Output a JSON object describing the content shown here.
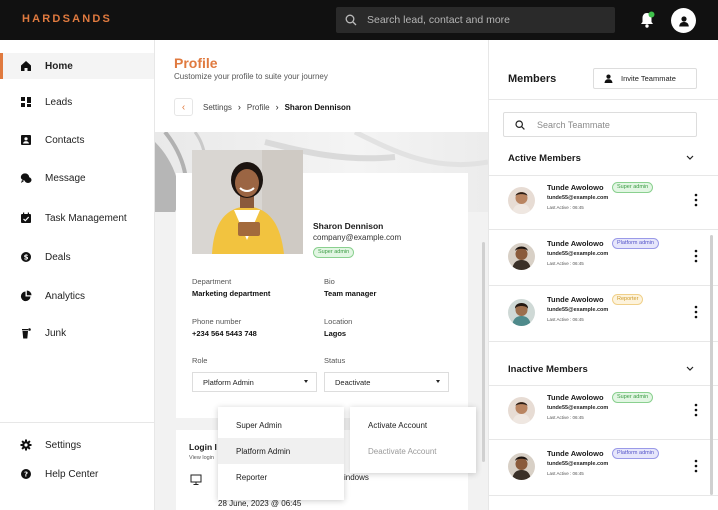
{
  "app": {
    "logo": "HARDSANDS"
  },
  "topbar": {
    "search_placeholder": "Search lead, contact and more"
  },
  "sidebar": {
    "items": [
      {
        "label": "Home",
        "icon": "home-icon",
        "active": true
      },
      {
        "label": "Leads",
        "icon": "leads-icon"
      },
      {
        "label": "Contacts",
        "icon": "contacts-icon"
      },
      {
        "label": "Message",
        "icon": "message-icon"
      },
      {
        "label": "Task Management",
        "icon": "task-icon"
      },
      {
        "label": "Deals",
        "icon": "deals-icon"
      },
      {
        "label": "Analytics",
        "icon": "analytics-icon"
      },
      {
        "label": "Junk",
        "icon": "junk-icon"
      }
    ],
    "bottom": [
      {
        "label": "Settings",
        "icon": "gear-icon"
      },
      {
        "label": "Help Center",
        "icon": "help-icon"
      }
    ]
  },
  "main": {
    "title": "Profile",
    "subtitle": "Customize your profile to suite your journey",
    "breadcrumb": [
      "Settings",
      "Profile",
      "Sharon Dennison"
    ],
    "profile": {
      "name": "Sharon Dennison",
      "email": "company@example.com",
      "badge": "Super admin",
      "department_label": "Department",
      "department": "Marketing department",
      "bio_label": "Bio",
      "bio": "Team manager",
      "phone_label": "Phone number",
      "phone": "+234 564 5443 748",
      "location_label": "Location",
      "location": "Lagos",
      "role_label": "Role",
      "role": "Platform Admin",
      "status_label": "Status",
      "status": "Deactivate"
    },
    "role_options": [
      "Super Admin",
      "Platform Admin",
      "Reporter"
    ],
    "status_options": [
      "Activate Account",
      "Deactivate Account"
    ],
    "login": {
      "title": "Login I",
      "subtitle": "View login",
      "os": "indows",
      "date": "28 June, 2023 @ 06:45"
    }
  },
  "members": {
    "title": "Members",
    "invite_label": "Invite Teammate",
    "search_placeholder": "Search Teammate",
    "active_title": "Active Members",
    "inactive_title": "Inactive Members",
    "active": [
      {
        "name": "Tunde Awolowo",
        "badge": "Super admin",
        "badge_color": "green",
        "email": "tunde55@example.com",
        "last_active": "Last Active : 06:45"
      },
      {
        "name": "Tunde Awolowo",
        "badge": "Platform admin",
        "badge_color": "blue",
        "email": "tunde55@example.com",
        "last_active": "Last Active : 06:45"
      },
      {
        "name": "Tunde Awolowo",
        "badge": "Reporter",
        "badge_color": "yellow",
        "email": "tunde55@example.com",
        "last_active": "Last Active : 06:45"
      }
    ],
    "inactive": [
      {
        "name": "Tunde Awolowo",
        "badge": "Super admin",
        "badge_color": "green",
        "email": "tunde55@example.com",
        "last_active": "Last Active : 06:45"
      },
      {
        "name": "Tunde Awolowo",
        "badge": "Platform admin",
        "badge_color": "blue",
        "email": "tunde55@example.com",
        "last_active": "Last Active : 06:45"
      }
    ]
  },
  "colors": {
    "accent": "#e07a3f",
    "topbar": "#111111",
    "notification_dot": "#3fc24b"
  }
}
